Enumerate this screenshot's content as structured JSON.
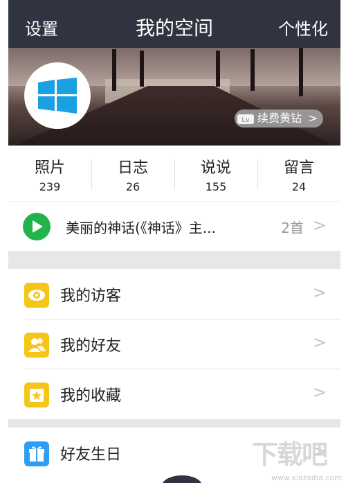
{
  "header": {
    "left": "设置",
    "title": "我的空间",
    "right": "个性化"
  },
  "cover": {
    "vip_label": "续费黄钻",
    "vip_chevron": ">"
  },
  "stats": [
    {
      "label": "照片",
      "value": "239"
    },
    {
      "label": "日志",
      "value": "26"
    },
    {
      "label": "说说",
      "value": "155"
    },
    {
      "label": "留言",
      "value": "24"
    }
  ],
  "music": {
    "title": "美丽的神话(《神话》主...",
    "count": "2首"
  },
  "menu": [
    {
      "label": "我的访客",
      "icon": "eye-icon"
    },
    {
      "label": "我的好友",
      "icon": "friends-icon"
    },
    {
      "label": "我的收藏",
      "icon": "favorite-star-icon"
    },
    {
      "label": "好友生日",
      "icon": "gift-icon"
    }
  ],
  "chevron": ">",
  "watermark": {
    "text": "下载吧",
    "url": "www.xiazaiba.com"
  },
  "colors": {
    "header_bg": "#2f3440",
    "play_green": "#20b44a",
    "icon_yellow": "#f5c518",
    "icon_blue": "#2e9ef4",
    "windows_blue": "#1ba1e2"
  }
}
